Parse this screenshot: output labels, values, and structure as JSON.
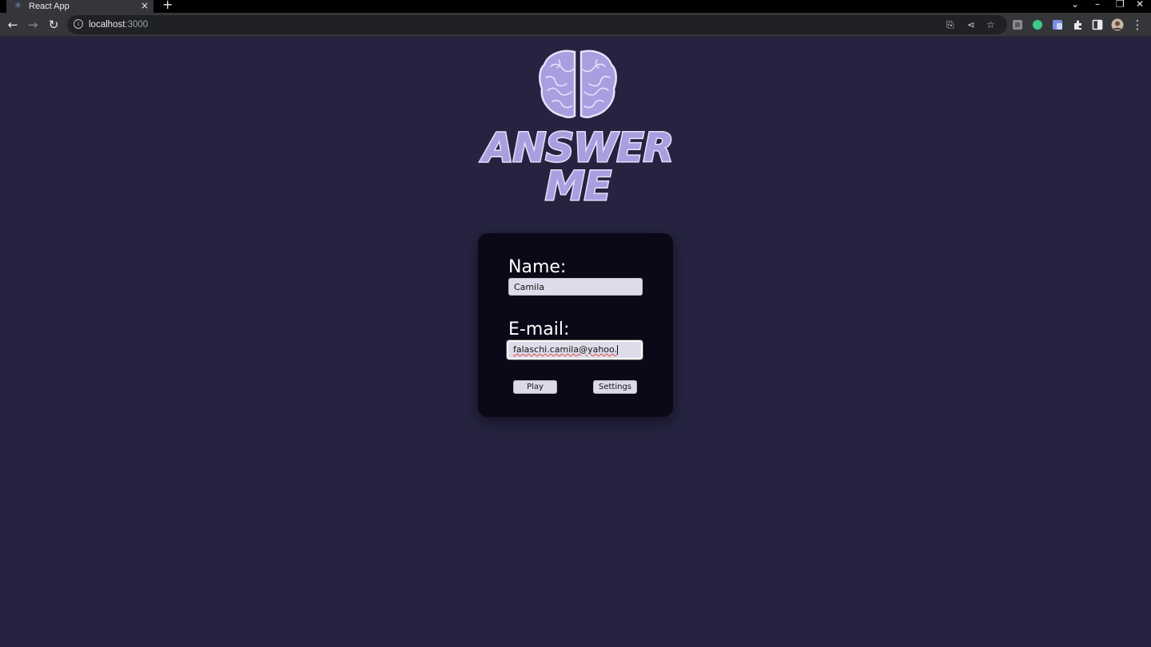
{
  "browser": {
    "tab_title": "React App",
    "tab_close": "×",
    "new_tab": "+",
    "url_host": "localhost",
    "url_port": ":3000",
    "win_minimize": "–",
    "win_restore": "❐",
    "win_close": "✕",
    "tab_search": "⌄"
  },
  "form": {
    "name_label": "Name:",
    "name_value": "Camila",
    "email_label": "E-mail:",
    "email_value": "falaschi.camila@yahoo.",
    "play_label": "Play",
    "settings_label": "Settings"
  },
  "logo": {
    "line1": "ANSWER",
    "line2": "ME"
  },
  "colors": {
    "background": "#25233f",
    "card": "#0c0818",
    "logo_fill": "#a89ee0",
    "logo_outline": "#e6e2fa",
    "input_bg": "#dedcea"
  }
}
